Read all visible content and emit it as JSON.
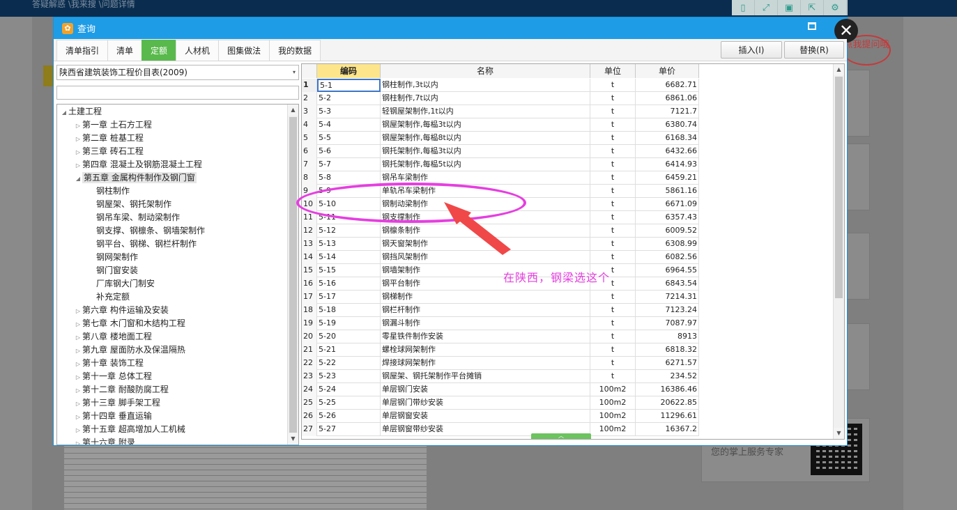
{
  "background": {
    "breadcrumb": "答疑解惑 \\我来搜 \\问题详情",
    "bubble": "点我提问哦",
    "service_text": "您的掌上服务专家"
  },
  "dialog": {
    "title": "查询",
    "tabs": [
      {
        "label": "清单指引",
        "active": false
      },
      {
        "label": "清单",
        "active": false
      },
      {
        "label": "定额",
        "active": true
      },
      {
        "label": "人材机",
        "active": false
      },
      {
        "label": "图集做法",
        "active": false
      },
      {
        "label": "我的数据",
        "active": false
      }
    ],
    "insert_button": "插入(I)",
    "replace_button": "替换(R)",
    "library_select": "陕西省建筑装饰工程价目表(2009)",
    "filter_value": ""
  },
  "tree": [
    {
      "label": "土建工程",
      "level": 0,
      "expanded": true
    },
    {
      "label": "第一章 土石方工程",
      "level": 1,
      "expanded": false
    },
    {
      "label": "第二章 桩基工程",
      "level": 1,
      "expanded": false
    },
    {
      "label": "第三章 砖石工程",
      "level": 1,
      "expanded": false
    },
    {
      "label": "第四章 混凝土及钢筋混凝土工程",
      "level": 1,
      "expanded": false
    },
    {
      "label": "第五章 金属构件制作及钢门窗",
      "level": 1,
      "expanded": true,
      "selected": true
    },
    {
      "label": "钢柱制作",
      "level": 2
    },
    {
      "label": "钢屋架、钢托架制作",
      "level": 2
    },
    {
      "label": "钢吊车梁、制动梁制作",
      "level": 2
    },
    {
      "label": "钢支撑、钢檩条、钢墙架制作",
      "level": 2
    },
    {
      "label": "钢平台、钢梯、钢栏杆制作",
      "level": 2
    },
    {
      "label": "钢网架制作",
      "level": 2
    },
    {
      "label": "钢门窗安装",
      "level": 2
    },
    {
      "label": "厂库钢大门制安",
      "level": 2
    },
    {
      "label": "补充定额",
      "level": 2
    },
    {
      "label": "第六章 构件运输及安装",
      "level": 1,
      "expanded": false
    },
    {
      "label": "第七章 木门窗和木结构工程",
      "level": 1,
      "expanded": false
    },
    {
      "label": "第八章 楼地面工程",
      "level": 1,
      "expanded": false
    },
    {
      "label": "第九章 屋面防水及保温隔热",
      "level": 1,
      "expanded": false
    },
    {
      "label": "第十章 装饰工程",
      "level": 1,
      "expanded": false
    },
    {
      "label": "第十一章 总体工程",
      "level": 1,
      "expanded": false
    },
    {
      "label": "第十二章 耐酸防腐工程",
      "level": 1,
      "expanded": false
    },
    {
      "label": "第十三章 脚手架工程",
      "level": 1,
      "expanded": false
    },
    {
      "label": "第十四章 垂直运输",
      "level": 1,
      "expanded": false
    },
    {
      "label": "第十五章 超高增加人工机械",
      "level": 1,
      "expanded": false
    },
    {
      "label": "第十六章 附录",
      "level": 1,
      "expanded": false
    }
  ],
  "grid": {
    "headers": {
      "code": "编码",
      "name": "名称",
      "unit": "单位",
      "price": "单价"
    },
    "rows": [
      {
        "n": "1",
        "code": "5-1",
        "name": "钢柱制作,3t以内",
        "unit": "t",
        "price": "6682.71"
      },
      {
        "n": "2",
        "code": "5-2",
        "name": "钢柱制作,7t以内",
        "unit": "t",
        "price": "6861.06"
      },
      {
        "n": "3",
        "code": "5-3",
        "name": "轻钢屋架制作,1t以内",
        "unit": "t",
        "price": "7121.7"
      },
      {
        "n": "4",
        "code": "5-4",
        "name": "钢屋架制作,每榀3t以内",
        "unit": "t",
        "price": "6380.74"
      },
      {
        "n": "5",
        "code": "5-5",
        "name": "钢屋架制作,每榀8t以内",
        "unit": "t",
        "price": "6168.34"
      },
      {
        "n": "6",
        "code": "5-6",
        "name": "钢托架制作,每榀3t以内",
        "unit": "t",
        "price": "6432.66"
      },
      {
        "n": "7",
        "code": "5-7",
        "name": "钢托架制作,每榀5t以内",
        "unit": "t",
        "price": "6414.93"
      },
      {
        "n": "8",
        "code": "5-8",
        "name": "钢吊车梁制作",
        "unit": "t",
        "price": "6459.21"
      },
      {
        "n": "9",
        "code": "5-9",
        "name": "单轨吊车梁制作",
        "unit": "t",
        "price": "5861.16"
      },
      {
        "n": "10",
        "code": "5-10",
        "name": "钢制动梁制作",
        "unit": "t",
        "price": "6671.09"
      },
      {
        "n": "11",
        "code": "5-11",
        "name": "钢支撑制作",
        "unit": "t",
        "price": "6357.43"
      },
      {
        "n": "12",
        "code": "5-12",
        "name": "钢檩条制作",
        "unit": "t",
        "price": "6009.52"
      },
      {
        "n": "13",
        "code": "5-13",
        "name": "钢天窗架制作",
        "unit": "t",
        "price": "6308.99"
      },
      {
        "n": "14",
        "code": "5-14",
        "name": "钢挡风架制作",
        "unit": "t",
        "price": "6082.56"
      },
      {
        "n": "15",
        "code": "5-15",
        "name": "钢墙架制作",
        "unit": "t",
        "price": "6964.55"
      },
      {
        "n": "16",
        "code": "5-16",
        "name": "钢平台制作",
        "unit": "t",
        "price": "6843.54"
      },
      {
        "n": "17",
        "code": "5-17",
        "name": "钢梯制作",
        "unit": "t",
        "price": "7214.31"
      },
      {
        "n": "18",
        "code": "5-18",
        "name": "钢栏杆制作",
        "unit": "t",
        "price": "7123.24"
      },
      {
        "n": "19",
        "code": "5-19",
        "name": "钢漏斗制作",
        "unit": "t",
        "price": "7087.97"
      },
      {
        "n": "20",
        "code": "5-20",
        "name": "零星铁件制作安装",
        "unit": "t",
        "price": "8913"
      },
      {
        "n": "21",
        "code": "5-21",
        "name": "螺栓球网架制作",
        "unit": "t",
        "price": "6818.32"
      },
      {
        "n": "22",
        "code": "5-22",
        "name": "焊接球网架制作",
        "unit": "t",
        "price": "6271.57"
      },
      {
        "n": "23",
        "code": "5-23",
        "name": "钢屋架、钢托架制作平台摊销",
        "unit": "t",
        "price": "234.52"
      },
      {
        "n": "24",
        "code": "5-24",
        "name": "单层钢门安装",
        "unit": "100m2",
        "price": "16386.46"
      },
      {
        "n": "25",
        "code": "5-25",
        "name": "单层钢门带纱安装",
        "unit": "100m2",
        "price": "20622.85"
      },
      {
        "n": "26",
        "code": "5-26",
        "name": "单层钢窗安装",
        "unit": "100m2",
        "price": "11296.61"
      },
      {
        "n": "27",
        "code": "5-27",
        "name": "单层钢窗带纱安装",
        "unit": "100m2",
        "price": "16367.2"
      }
    ]
  },
  "annotation": {
    "text": "在陕西，钢梁选这个",
    "color": "#e63ee0"
  }
}
